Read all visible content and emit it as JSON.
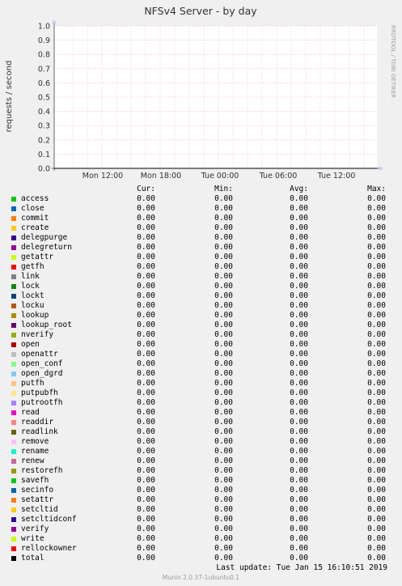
{
  "chart_data": {
    "type": "line",
    "title": "NFSv4 Server - by day",
    "ylabel": "requests / second",
    "watermark": "RRDTOOL / TOBI OETIKER",
    "ylim": [
      0,
      1.0
    ],
    "yticks": [
      "0.0",
      "0.1",
      "0.2",
      "0.3",
      "0.4",
      "0.5",
      "0.6",
      "0.7",
      "0.8",
      "0.9",
      "1.0"
    ],
    "xticks": [
      "Mon 12:00",
      "Mon 18:00",
      "Tue 00:00",
      "Tue 06:00",
      "Tue 12:00"
    ],
    "grid": true,
    "colors": {
      "background": "#f0f0f0",
      "plot_background": "#ffffff",
      "grid": "#e8a0a0",
      "axis": "#666666",
      "arrow": "#ccccff"
    }
  },
  "legend": {
    "headers": {
      "cur": "Cur:",
      "min": "Min:",
      "avg": "Avg:",
      "max": "Max:"
    },
    "rows": [
      {
        "name": "access",
        "color": "#00cc00",
        "cur": "0.00",
        "min": "0.00",
        "avg": "0.00",
        "max": "0.00"
      },
      {
        "name": "close",
        "color": "#0066b3",
        "cur": "0.00",
        "min": "0.00",
        "avg": "0.00",
        "max": "0.00"
      },
      {
        "name": "commit",
        "color": "#ff8000",
        "cur": "0.00",
        "min": "0.00",
        "avg": "0.00",
        "max": "0.00"
      },
      {
        "name": "create",
        "color": "#ffcc00",
        "cur": "0.00",
        "min": "0.00",
        "avg": "0.00",
        "max": "0.00"
      },
      {
        "name": "delegpurge",
        "color": "#330099",
        "cur": "0.00",
        "min": "0.00",
        "avg": "0.00",
        "max": "0.00"
      },
      {
        "name": "delegreturn",
        "color": "#990099",
        "cur": "0.00",
        "min": "0.00",
        "avg": "0.00",
        "max": "0.00"
      },
      {
        "name": "getattr",
        "color": "#ccff00",
        "cur": "0.00",
        "min": "0.00",
        "avg": "0.00",
        "max": "0.00"
      },
      {
        "name": "getfh",
        "color": "#ff0000",
        "cur": "0.00",
        "min": "0.00",
        "avg": "0.00",
        "max": "0.00"
      },
      {
        "name": "link",
        "color": "#808080",
        "cur": "0.00",
        "min": "0.00",
        "avg": "0.00",
        "max": "0.00"
      },
      {
        "name": "lock",
        "color": "#008f00",
        "cur": "0.00",
        "min": "0.00",
        "avg": "0.00",
        "max": "0.00"
      },
      {
        "name": "lockt",
        "color": "#00487d",
        "cur": "0.00",
        "min": "0.00",
        "avg": "0.00",
        "max": "0.00"
      },
      {
        "name": "locku",
        "color": "#b35a00",
        "cur": "0.00",
        "min": "0.00",
        "avg": "0.00",
        "max": "0.00"
      },
      {
        "name": "lookup",
        "color": "#b38f00",
        "cur": "0.00",
        "min": "0.00",
        "avg": "0.00",
        "max": "0.00"
      },
      {
        "name": "lookup_root",
        "color": "#6b006b",
        "cur": "0.00",
        "min": "0.00",
        "avg": "0.00",
        "max": "0.00"
      },
      {
        "name": "nverify",
        "color": "#8fb300",
        "cur": "0.00",
        "min": "0.00",
        "avg": "0.00",
        "max": "0.00"
      },
      {
        "name": "open",
        "color": "#b30000",
        "cur": "0.00",
        "min": "0.00",
        "avg": "0.00",
        "max": "0.00"
      },
      {
        "name": "openattr",
        "color": "#bebebe",
        "cur": "0.00",
        "min": "0.00",
        "avg": "0.00",
        "max": "0.00"
      },
      {
        "name": "open_conf",
        "color": "#80ff80",
        "cur": "0.00",
        "min": "0.00",
        "avg": "0.00",
        "max": "0.00"
      },
      {
        "name": "open_dgrd",
        "color": "#80c9ff",
        "cur": "0.00",
        "min": "0.00",
        "avg": "0.00",
        "max": "0.00"
      },
      {
        "name": "putfh",
        "color": "#ffc080",
        "cur": "0.00",
        "min": "0.00",
        "avg": "0.00",
        "max": "0.00"
      },
      {
        "name": "putpubfh",
        "color": "#ffe680",
        "cur": "0.00",
        "min": "0.00",
        "avg": "0.00",
        "max": "0.00"
      },
      {
        "name": "putrootfh",
        "color": "#aa80ff",
        "cur": "0.00",
        "min": "0.00",
        "avg": "0.00",
        "max": "0.00"
      },
      {
        "name": "read",
        "color": "#ee00cc",
        "cur": "0.00",
        "min": "0.00",
        "avg": "0.00",
        "max": "0.00"
      },
      {
        "name": "readdir",
        "color": "#ff8080",
        "cur": "0.00",
        "min": "0.00",
        "avg": "0.00",
        "max": "0.00"
      },
      {
        "name": "readlink",
        "color": "#666600",
        "cur": "0.00",
        "min": "0.00",
        "avg": "0.00",
        "max": "0.00"
      },
      {
        "name": "remove",
        "color": "#ffbfff",
        "cur": "0.00",
        "min": "0.00",
        "avg": "0.00",
        "max": "0.00"
      },
      {
        "name": "rename",
        "color": "#00ffcc",
        "cur": "0.00",
        "min": "0.00",
        "avg": "0.00",
        "max": "0.00"
      },
      {
        "name": "renew",
        "color": "#cc6699",
        "cur": "0.00",
        "min": "0.00",
        "avg": "0.00",
        "max": "0.00"
      },
      {
        "name": "restorefh",
        "color": "#999900",
        "cur": "0.00",
        "min": "0.00",
        "avg": "0.00",
        "max": "0.00"
      },
      {
        "name": "savefh",
        "color": "#00cc00",
        "cur": "0.00",
        "min": "0.00",
        "avg": "0.00",
        "max": "0.00"
      },
      {
        "name": "secinfo",
        "color": "#0066b3",
        "cur": "0.00",
        "min": "0.00",
        "avg": "0.00",
        "max": "0.00"
      },
      {
        "name": "setattr",
        "color": "#ff8000",
        "cur": "0.00",
        "min": "0.00",
        "avg": "0.00",
        "max": "0.00"
      },
      {
        "name": "setcltid",
        "color": "#ffcc00",
        "cur": "0.00",
        "min": "0.00",
        "avg": "0.00",
        "max": "0.00"
      },
      {
        "name": "setcltidconf",
        "color": "#330099",
        "cur": "0.00",
        "min": "0.00",
        "avg": "0.00",
        "max": "0.00"
      },
      {
        "name": "verify",
        "color": "#990099",
        "cur": "0.00",
        "min": "0.00",
        "avg": "0.00",
        "max": "0.00"
      },
      {
        "name": "write",
        "color": "#ccff00",
        "cur": "0.00",
        "min": "0.00",
        "avg": "0.00",
        "max": "0.00"
      },
      {
        "name": "rellockowner",
        "color": "#ff0000",
        "cur": "0.00",
        "min": "0.00",
        "avg": "0.00",
        "max": "0.00"
      },
      {
        "name": "total",
        "color": "#000000",
        "cur": "0.00",
        "min": "0.00",
        "avg": "0.00",
        "max": "0.00"
      }
    ]
  },
  "footer": {
    "last_update": "Last update: Tue Jan 15 16:10:51 2019",
    "munin": "Munin 2.0.37-1ubuntu0.1"
  }
}
